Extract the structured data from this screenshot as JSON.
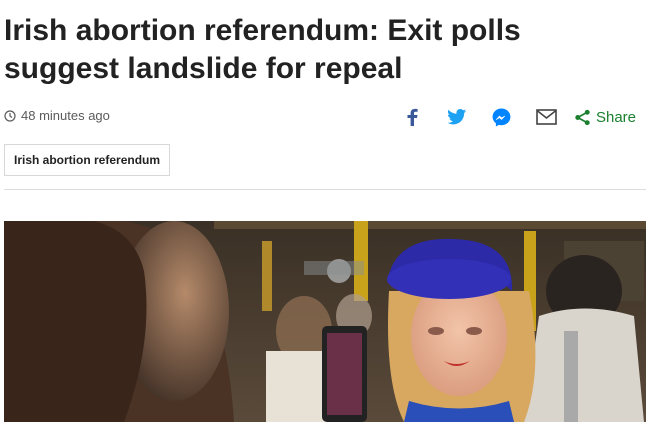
{
  "article": {
    "headline": "Irish abortion referendum: Exit polls suggest landslide for repeal",
    "timestamp": "48 minutes ago",
    "tag": "Irish abortion referendum"
  },
  "share": {
    "label": "Share",
    "icons": [
      "facebook-icon",
      "twitter-icon",
      "messenger-icon",
      "email-icon",
      "share-icon"
    ]
  },
  "colors": {
    "facebook": "#3b5998",
    "twitter": "#1da1f2",
    "messenger": "#0084ff",
    "share_green": "#1a7f2e",
    "headline_text": "#222222"
  }
}
